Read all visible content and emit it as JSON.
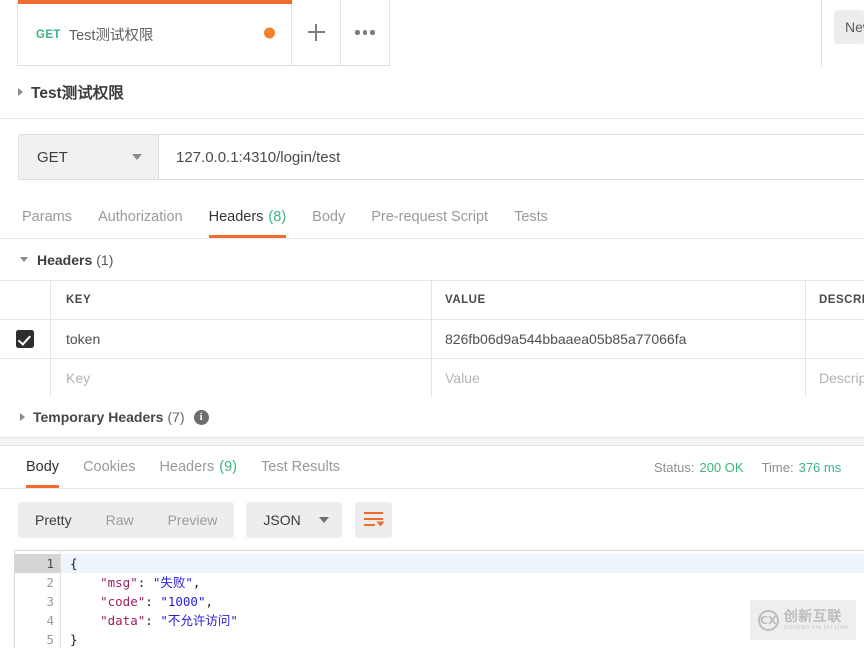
{
  "tabstrip": {
    "tab": {
      "method": "GET",
      "title": "Test测试权限",
      "unsaved_dot": "●"
    },
    "add_tab_label": "+",
    "more_label": "•••",
    "new_button_label": "New"
  },
  "breadcrumb": {
    "title": "Test测试权限"
  },
  "request": {
    "method": "GET",
    "url": "127.0.0.1:4310/login/test",
    "tabs": [
      {
        "label": "Params",
        "count": "",
        "active": false
      },
      {
        "label": "Authorization",
        "count": "",
        "active": false
      },
      {
        "label": "Headers",
        "count": "(8)",
        "active": true
      },
      {
        "label": "Body",
        "count": "",
        "active": false
      },
      {
        "label": "Pre-request Script",
        "count": "",
        "active": false
      },
      {
        "label": "Tests",
        "count": "",
        "active": false
      }
    ]
  },
  "headers_section": {
    "label": "Headers",
    "count": "(1)",
    "columns": {
      "key": "KEY",
      "value": "VALUE",
      "description": "DESCRIPTION"
    },
    "rows": [
      {
        "checked": true,
        "key": "token",
        "value": "826fb06d9a544bbaaea05b85a77066fa",
        "description": ""
      }
    ],
    "placeholder_row": {
      "key": "Key",
      "value": "Value",
      "description": "Description"
    }
  },
  "temporary_headers": {
    "label": "Temporary Headers",
    "count": "(7)",
    "info_glyph": "i"
  },
  "response": {
    "tabs": [
      {
        "label": "Body",
        "count": "",
        "active": true
      },
      {
        "label": "Cookies",
        "count": "",
        "active": false
      },
      {
        "label": "Headers",
        "count": "(9)",
        "active": false
      },
      {
        "label": "Test Results",
        "count": "",
        "active": false
      }
    ],
    "status_label": "Status:",
    "status_value": "200 OK",
    "time_label": "Time:",
    "time_value": "376 ms",
    "view_modes": [
      {
        "label": "Pretty",
        "active": true
      },
      {
        "label": "Raw",
        "active": false
      },
      {
        "label": "Preview",
        "active": false
      }
    ],
    "format": "JSON",
    "wrap_icon": "word-wrap-icon",
    "body": {
      "language": "json",
      "line_numbers": [
        "1",
        "2",
        "3",
        "4",
        "5"
      ],
      "lines": [
        {
          "n": "1",
          "tokens": [
            {
              "t": "punct",
              "v": "{"
            }
          ]
        },
        {
          "n": "2",
          "tokens": [
            {
              "t": "punct",
              "v": "    "
            },
            {
              "t": "key",
              "v": "\"msg\""
            },
            {
              "t": "punct",
              "v": ": "
            },
            {
              "t": "str",
              "v": "\"失败\""
            },
            {
              "t": "punct",
              "v": ","
            }
          ]
        },
        {
          "n": "3",
          "tokens": [
            {
              "t": "punct",
              "v": "    "
            },
            {
              "t": "key",
              "v": "\"code\""
            },
            {
              "t": "punct",
              "v": ": "
            },
            {
              "t": "str",
              "v": "\"1000\""
            },
            {
              "t": "punct",
              "v": ","
            }
          ]
        },
        {
          "n": "4",
          "tokens": [
            {
              "t": "punct",
              "v": "    "
            },
            {
              "t": "key",
              "v": "\"data\""
            },
            {
              "t": "punct",
              "v": ": "
            },
            {
              "t": "str",
              "v": "\"不允许访问\""
            }
          ]
        },
        {
          "n": "5",
          "tokens": [
            {
              "t": "punct",
              "v": "}"
            }
          ]
        }
      ],
      "raw_text": "{\n    \"msg\": \"失败\",\n    \"code\": \"1000\",\n    \"data\": \"不允许访问\"\n}"
    }
  },
  "watermark": {
    "badge": "CX",
    "cn": "创新互联",
    "en": "CHUANG XIN HU LIAN"
  },
  "colors": {
    "accent_orange": "#ef6c2e",
    "method_green": "#3ab682",
    "status_green": "#3ab682",
    "json_key": "#9b2060",
    "json_string": "#2a20d8"
  }
}
